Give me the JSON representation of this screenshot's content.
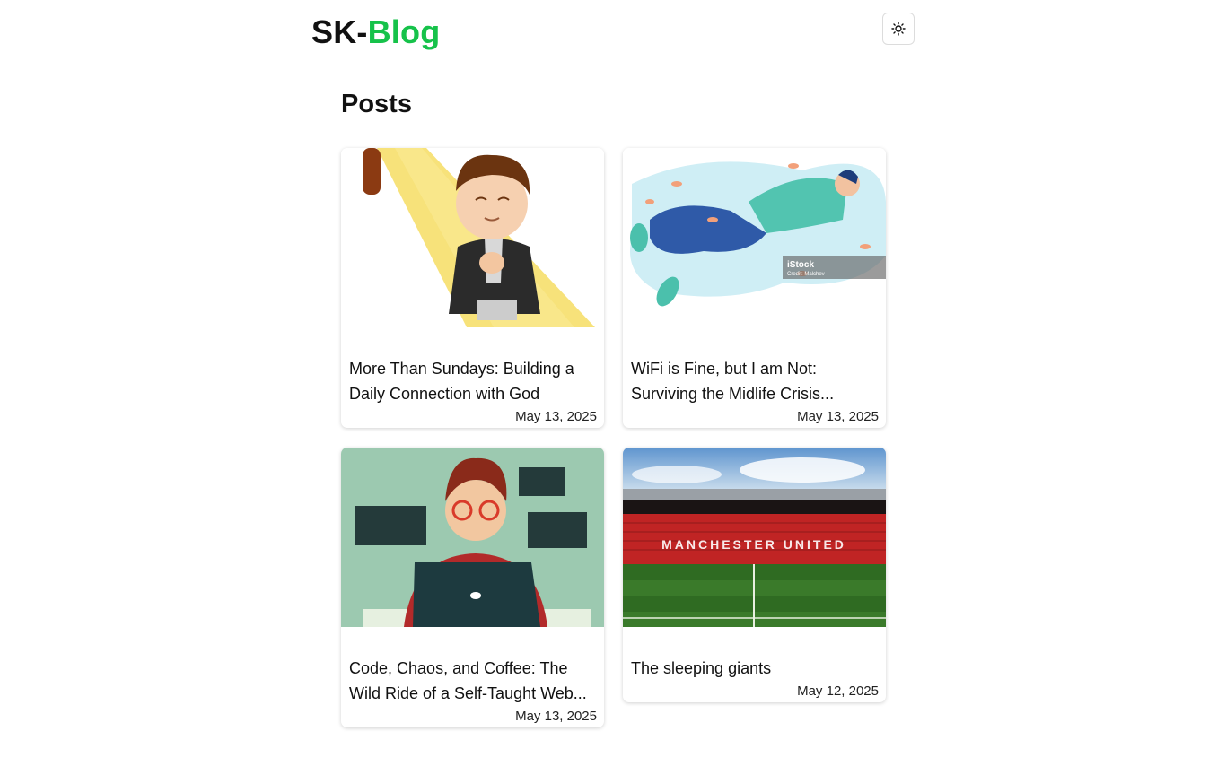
{
  "header": {
    "logo_prefix": "SK-",
    "logo_suffix": "Blog",
    "theme_toggle_icon": "sun-icon"
  },
  "page": {
    "title": "Posts"
  },
  "colors": {
    "brand_green": "#16c24a",
    "text": "#111111"
  },
  "posts": [
    {
      "title_line1": "More Than Sundays: Building a",
      "title_line2": "Daily Connection with God",
      "date": "May 13, 2025",
      "image": "praying-boy-illustration"
    },
    {
      "title_line1": "WiFi is Fine, but I am Not:",
      "title_line2": "Surviving the Midlife Crisis...",
      "date": "May 13, 2025",
      "image": "man-lying-in-leaves-illustration",
      "image_watermark": "iStock",
      "image_credit": "Credit: Malchev"
    },
    {
      "title_line1": "Code, Chaos, and Coffee: The",
      "title_line2": "Wild Ride of a Self-Taught Web...",
      "date": "May 13, 2025",
      "image": "developer-at-laptop-illustration"
    },
    {
      "title_line1": "The sleeping giants",
      "title_line2": "",
      "date": "May 12, 2025",
      "image": "football-stadium-photo",
      "image_text": "MANCHESTER UNITED"
    }
  ]
}
